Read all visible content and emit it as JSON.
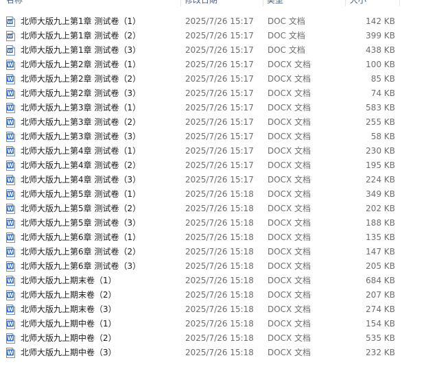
{
  "header": {
    "name": "名称",
    "date": "修改日期",
    "type": "类型",
    "size": "大小"
  },
  "files": [
    {
      "name": "北师大版九上第1章 测试卷（1）",
      "date": "2025/7/26 15:17",
      "type": "DOC 文档",
      "size": "142 KB",
      "icon": "doc-file-icon"
    },
    {
      "name": "北师大版九上第1章 测试卷（2）",
      "date": "2025/7/26 15:17",
      "type": "DOC 文档",
      "size": "399 KB",
      "icon": "doc-file-icon"
    },
    {
      "name": "北师大版九上第1章 测试卷（3）",
      "date": "2025/7/26 15:17",
      "type": "DOC 文档",
      "size": "438 KB",
      "icon": "doc-file-icon"
    },
    {
      "name": "北师大版九上第2章 测试卷（1）",
      "date": "2025/7/26 15:17",
      "type": "DOCX 文档",
      "size": "100 KB",
      "icon": "docx-file-icon"
    },
    {
      "name": "北师大版九上第2章 测试卷（2）",
      "date": "2025/7/26 15:17",
      "type": "DOCX 文档",
      "size": "85 KB",
      "icon": "docx-file-icon"
    },
    {
      "name": "北师大版九上第2章 测试卷（3）",
      "date": "2025/7/26 15:17",
      "type": "DOCX 文档",
      "size": "74 KB",
      "icon": "docx-file-icon"
    },
    {
      "name": "北师大版九上第3章 测试卷（1）",
      "date": "2025/7/26 15:17",
      "type": "DOCX 文档",
      "size": "583 KB",
      "icon": "docx-file-icon"
    },
    {
      "name": "北师大版九上第3章 测试卷（2）",
      "date": "2025/7/26 15:17",
      "type": "DOCX 文档",
      "size": "255 KB",
      "icon": "docx-file-icon"
    },
    {
      "name": "北师大版九上第3章 测试卷（3）",
      "date": "2025/7/26 15:17",
      "type": "DOCX 文档",
      "size": "58 KB",
      "icon": "docx-file-icon"
    },
    {
      "name": "北师大版九上第4章 测试卷（1）",
      "date": "2025/7/26 15:17",
      "type": "DOCX 文档",
      "size": "230 KB",
      "icon": "docx-file-icon"
    },
    {
      "name": "北师大版九上第4章 测试卷（2）",
      "date": "2025/7/26 15:17",
      "type": "DOCX 文档",
      "size": "195 KB",
      "icon": "docx-file-icon"
    },
    {
      "name": "北师大版九上第4章 测试卷（3）",
      "date": "2025/7/26 15:17",
      "type": "DOCX 文档",
      "size": "224 KB",
      "icon": "docx-file-icon"
    },
    {
      "name": "北师大版九上第5章 测试卷（1）",
      "date": "2025/7/26 15:18",
      "type": "DOCX 文档",
      "size": "349 KB",
      "icon": "docx-file-icon"
    },
    {
      "name": "北师大版九上第5章 测试卷（2）",
      "date": "2025/7/26 15:18",
      "type": "DOCX 文档",
      "size": "202 KB",
      "icon": "docx-file-icon"
    },
    {
      "name": "北师大版九上第5章 测试卷（3）",
      "date": "2025/7/26 15:18",
      "type": "DOCX 文档",
      "size": "188 KB",
      "icon": "docx-file-icon"
    },
    {
      "name": "北师大版九上第6章 测试卷（1）",
      "date": "2025/7/26 15:18",
      "type": "DOCX 文档",
      "size": "135 KB",
      "icon": "docx-file-icon"
    },
    {
      "name": "北师大版九上第6章 测试卷（2）",
      "date": "2025/7/26 15:18",
      "type": "DOCX 文档",
      "size": "147 KB",
      "icon": "docx-file-icon"
    },
    {
      "name": "北师大版九上第6章 测试卷（3）",
      "date": "2025/7/26 15:18",
      "type": "DOCX 文档",
      "size": "205 KB",
      "icon": "docx-file-icon"
    },
    {
      "name": "北师大版九上期末卷（1）",
      "date": "2025/7/26 15:18",
      "type": "DOCX 文档",
      "size": "684 KB",
      "icon": "docx-file-icon"
    },
    {
      "name": "北师大版九上期末卷（2）",
      "date": "2025/7/26 15:18",
      "type": "DOCX 文档",
      "size": "207 KB",
      "icon": "docx-file-icon"
    },
    {
      "name": "北师大版九上期末卷（3）",
      "date": "2025/7/26 15:18",
      "type": "DOCX 文档",
      "size": "274 KB",
      "icon": "docx-file-icon"
    },
    {
      "name": "北师大版九上期中卷（1）",
      "date": "2025/7/26 15:18",
      "type": "DOCX 文档",
      "size": "154 KB",
      "icon": "docx-file-icon"
    },
    {
      "name": "北师大版九上期中卷（2）",
      "date": "2025/7/26 15:18",
      "type": "DOCX 文档",
      "size": "535 KB",
      "icon": "docx-file-icon"
    },
    {
      "name": "北师大版九上期中卷（3）",
      "date": "2025/7/26 15:18",
      "type": "DOCX 文档",
      "size": "232 KB",
      "icon": "docx-file-icon"
    }
  ]
}
